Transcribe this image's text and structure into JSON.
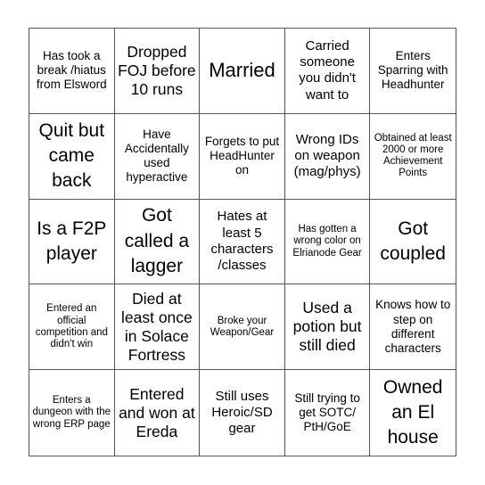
{
  "board": {
    "cells": [
      "Has took a break /hiatus from Elsword",
      "Dropped FOJ before 10 runs",
      "Married",
      "Carried someone you didn't want to",
      "Enters Sparring with Headhunter",
      "Quit but came back",
      "Have Accidentally used hyperactive",
      "Forgets to put HeadHunter on",
      "Wrong IDs on weapon (mag/phys)",
      "Obtained at least 2000 or more Achievement Points",
      "Is a F2P player",
      "Got called a lagger",
      "Hates at least 5 characters /classes",
      "Has gotten a wrong color on Elrianode Gear",
      "Got coupled",
      "Entered an official competition and didn't win",
      "Died at least once in Solace Fortress",
      "Broke your Weapon/Gear",
      "Used a potion but still died",
      "Knows how to step on different characters",
      "Enters a dungeon with the wrong ERP page",
      "Entered and won at Ereda",
      "Still uses Heroic/SD gear",
      "Still trying to get SOTC/ PtH/GoE",
      "Owned an El house"
    ]
  }
}
